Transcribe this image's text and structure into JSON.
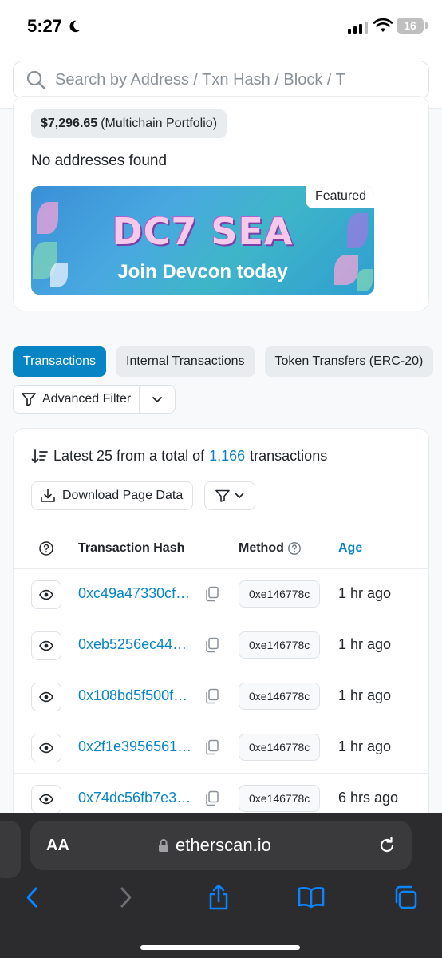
{
  "status_bar": {
    "time": "5:27",
    "battery": "16"
  },
  "search": {
    "placeholder": "Search by Address / Txn Hash / Block / T"
  },
  "overview": {
    "portfolio_value": "$7,296.65",
    "portfolio_label": "(Multichain Portfolio)",
    "no_addresses": "No addresses found",
    "banner": {
      "badge": "Featured",
      "title": "DC7 SEA",
      "tagline": "Join Devcon today"
    }
  },
  "tabs": [
    {
      "label": "Transactions",
      "active": true
    },
    {
      "label": "Internal Transactions",
      "active": false
    },
    {
      "label": "Token Transfers (ERC-20)",
      "active": false
    }
  ],
  "advanced_filter": {
    "label": "Advanced Filter"
  },
  "transactions": {
    "summary_prefix": "Latest 25 from a total of",
    "total": "1,166",
    "summary_suffix": "transactions",
    "download_label": "Download Page Data",
    "headers": {
      "hash": "Transaction Hash",
      "method": "Method",
      "age": "Age"
    },
    "rows": [
      {
        "hash": "0xc49a47330cf…",
        "method": "0xe146778c",
        "age": "1 hr ago"
      },
      {
        "hash": "0xeb5256ec44…",
        "method": "0xe146778c",
        "age": "1 hr ago"
      },
      {
        "hash": "0x108bd5f500f…",
        "method": "0xe146778c",
        "age": "1 hr ago"
      },
      {
        "hash": "0x2f1e3956561…",
        "method": "0xe146778c",
        "age": "1 hr ago"
      },
      {
        "hash": "0x74dc56fb7e3…",
        "method": "0xe146778c",
        "age": "6 hrs ago"
      }
    ]
  },
  "browser": {
    "text_size_label": "AA",
    "domain": "etherscan.io"
  },
  "colors": {
    "accent": "#0784c3",
    "browser_bg": "#2c2c2e",
    "ios_blue": "#0a84ff"
  }
}
